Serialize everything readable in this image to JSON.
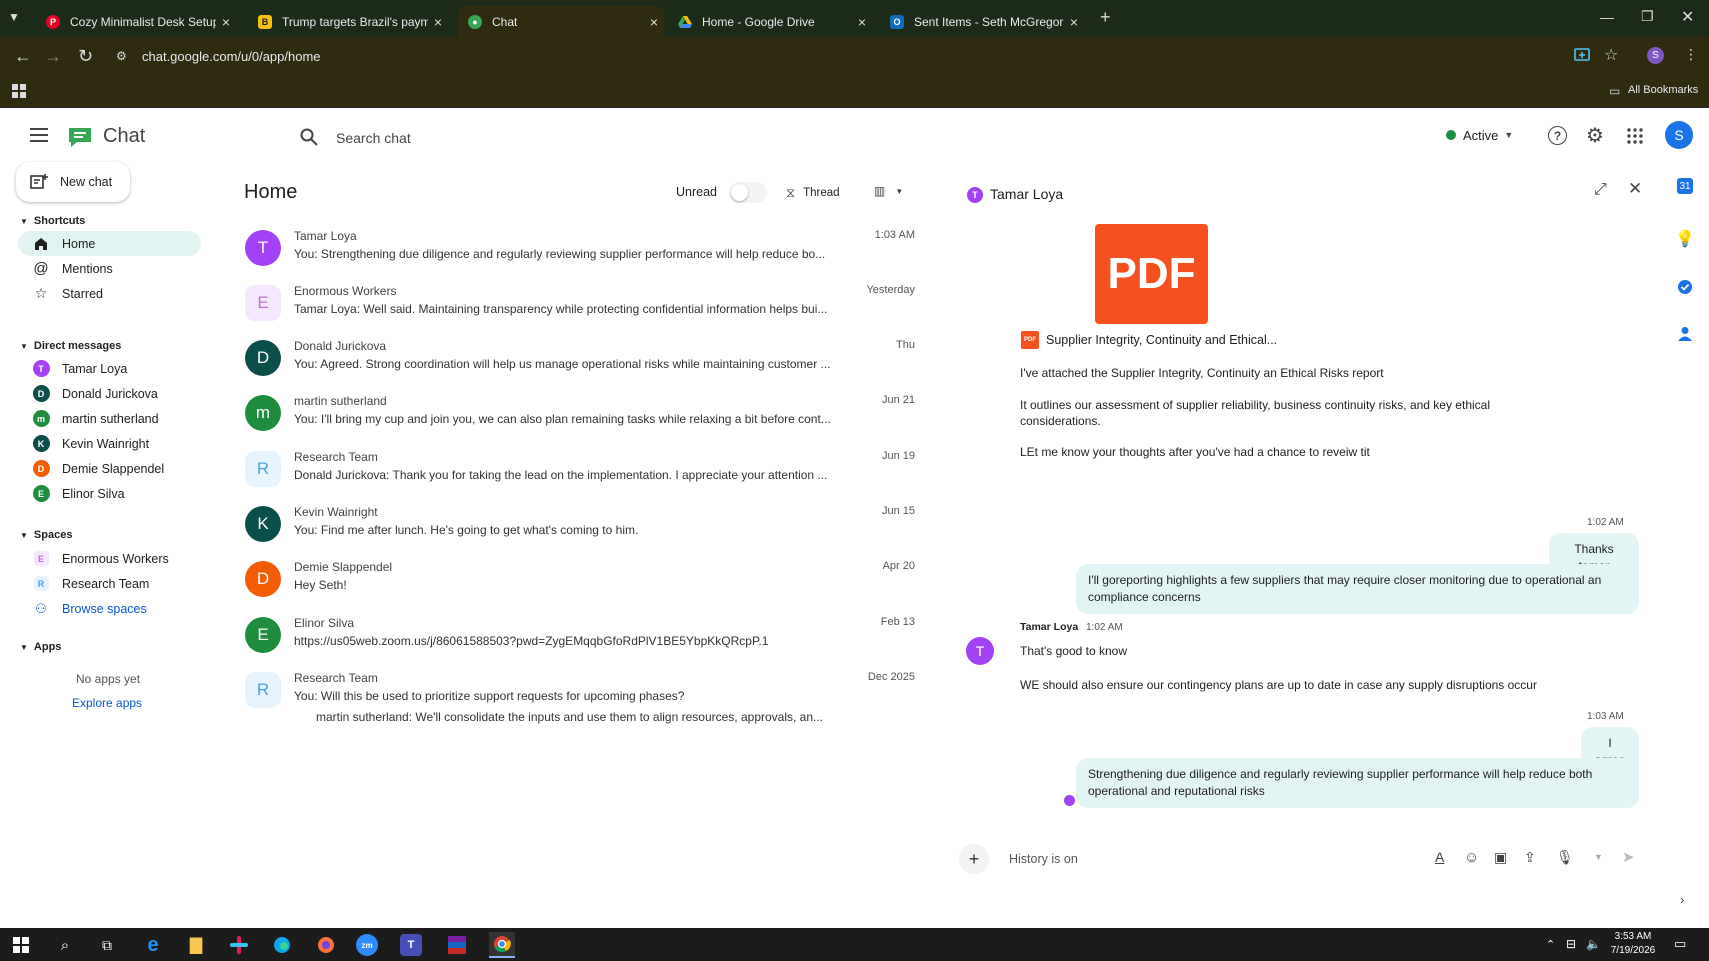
{
  "browser": {
    "tabs": [
      {
        "title": "Cozy Minimalist Desk Setup Id",
        "favicon": "pinterest-icon",
        "color": "#e60023"
      },
      {
        "title": "Trump targets Brazil's payment",
        "favicon": "news-icon",
        "color": "#f4c20d"
      },
      {
        "title": "Chat",
        "favicon": "google-chat-icon",
        "color": "#34a853"
      },
      {
        "title": "Home - Google Drive",
        "favicon": "google-drive-icon",
        "color": "#fbbc04"
      },
      {
        "title": "Sent Items - Seth McGregor - C",
        "favicon": "outlook-icon",
        "color": "#0f6cbd"
      }
    ],
    "url": "chat.google.com/u/0/app/home",
    "bookmarks_label": "All Bookmarks",
    "profile_initial": "S"
  },
  "header": {
    "app_name": "Chat",
    "search_placeholder": "Search chat",
    "status": "Active",
    "status_color": "#1e8e3e",
    "avatar_initial": "S",
    "avatar_color": "#1a73e8"
  },
  "sidebar": {
    "new_chat": "New chat",
    "shortcuts_label": "Shortcuts",
    "shortcuts": [
      {
        "label": "Home",
        "icon": "home-icon"
      },
      {
        "label": "Mentions",
        "icon": "at-icon"
      },
      {
        "label": "Starred",
        "icon": "star-icon"
      }
    ],
    "dm_label": "Direct messages",
    "direct_messages": [
      {
        "label": "Tamar Loya",
        "initial": "T",
        "color": "#a142f4"
      },
      {
        "label": "Donald Jurickova",
        "initial": "D",
        "color": "#0b4f4a"
      },
      {
        "label": "martin sutherland",
        "initial": "m",
        "color": "#1e8e3e"
      },
      {
        "label": "Kevin Wainright",
        "initial": "K",
        "color": "#0b4f4a"
      },
      {
        "label": "Demie Slappendel",
        "initial": "D",
        "color": "#f25c05"
      },
      {
        "label": "Elinor Silva",
        "initial": "E",
        "color": "#1e8e3e"
      }
    ],
    "spaces_label": "Spaces",
    "spaces": [
      {
        "label": "Enormous Workers",
        "initial": "E",
        "color": "#c26ed8"
      },
      {
        "label": "Research Team",
        "initial": "R",
        "color": "#4aa3df"
      }
    ],
    "browse_spaces": "Browse spaces",
    "apps_label": "Apps",
    "no_apps": "No apps yet",
    "explore_apps": "Explore apps"
  },
  "home": {
    "title": "Home",
    "unread_label": "Unread",
    "thread_label": "Thread",
    "conversations": [
      {
        "name": "Tamar Loya",
        "preview": "You: Strengthening due diligence and regularly reviewing supplier performance will help reduce bo...",
        "time": "1:03 AM",
        "initial": "T",
        "color": "#a142f4"
      },
      {
        "name": "Enormous Workers",
        "preview": "Tamar Loya: Well said. Maintaining transparency while protecting confidential information helps bui...",
        "time": "Yesterday",
        "initial": "E",
        "color": "#f3e8fd",
        "text_color": "#c26ed8"
      },
      {
        "name": "Donald Jurickova",
        "preview": "You: Agreed. Strong coordination will help us manage operational risks while maintaining customer ...",
        "time": "Thu",
        "initial": "D",
        "color": "#0b4f4a"
      },
      {
        "name": "martin sutherland",
        "preview": "You: I'll bring my cup and join you, we can also plan remaining tasks while relaxing a bit before cont...",
        "time": "Jun 21",
        "initial": "m",
        "color": "#1e8e3e"
      },
      {
        "name": "Research Team",
        "preview": "Donald Jurickova: Thank you for taking the lead on the implementation. I appreciate your attention ...",
        "time": "Jun 19",
        "initial": "R",
        "color": "#e8f4fd",
        "text_color": "#4aa3df"
      },
      {
        "name": "Kevin Wainright",
        "preview": "You: Find me after lunch. He's going to get what's coming to him.",
        "time": "Jun 15",
        "initial": "K",
        "color": "#0b4f4a"
      },
      {
        "name": "Demie Slappendel",
        "preview": "Hey Seth!",
        "time": "Apr 20",
        "initial": "D",
        "color": "#f25c05"
      },
      {
        "name": "Elinor Silva",
        "preview": "https://us05web.zoom.us/j/86061588503?pwd=ZygEMqqbGfoRdPlV1BE5YbpKkQRcpP.1",
        "time": "Feb 13",
        "initial": "E",
        "color": "#1e8e3e"
      },
      {
        "name": "Research Team",
        "preview": "You: Will this be used to prioritize support requests for upcoming phases?",
        "time": "Dec 2025",
        "initial": "R",
        "color": "#e8f4fd",
        "text_color": "#4aa3df"
      }
    ],
    "thread_reply": "martin sutherland: We'll consolidate the inputs and use them to align resources, approvals, an..."
  },
  "conversation": {
    "title": "Tamar Loya",
    "pdf_label": "PDF",
    "attachment_name": "Supplier Integrity, Continuity and Ethical...",
    "incoming1": [
      "I've attached the Supplier Integrity, Continuity an Ethical Risks report",
      "It outlines our assessment of supplier reliability, business continuity risks, and key ethical",
      "considerations.",
      "LEt me know your thoughts after you've had a chance to reveiw tit"
    ],
    "time1": "1:02 AM",
    "out1": "Thanks tamar",
    "out2": "I'll goreporting highlights a few suppliers that may require closer monitoring due to operational an compliance concerns",
    "sender2": "Tamar Loya",
    "sender2_time": "1:02 AM",
    "incoming2": [
      "That's good to know",
      "WE should also ensure our contingency plans are up to date in case any supply disruptions occur"
    ],
    "time2": "1:03 AM",
    "out3": "I agree",
    "out4": "Strengthening due diligence and regularly reviewing supplier performance will help reduce both operational and reputational risks",
    "composer_placeholder": "History is on"
  },
  "taskbar": {
    "time": "3:53 AM",
    "date": "7/19/2026"
  }
}
